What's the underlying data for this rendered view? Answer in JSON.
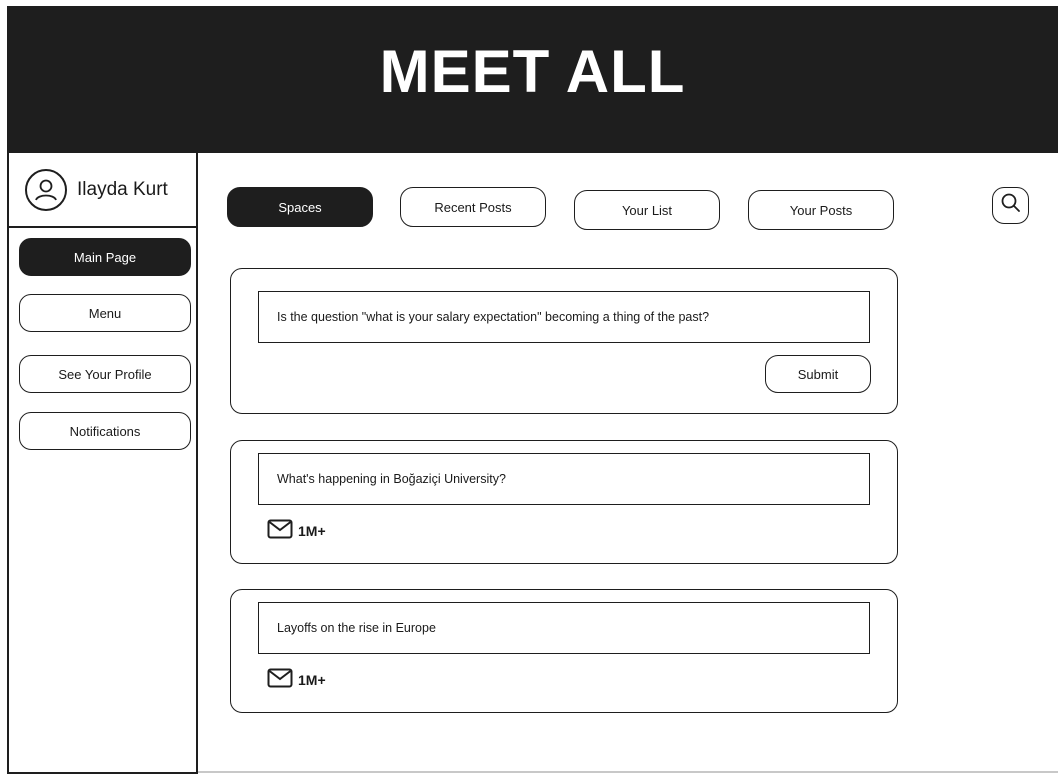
{
  "app": {
    "title": "MEET ALL"
  },
  "user": {
    "name": "Ilayda Kurt",
    "avatar_icon": "user-circle-icon"
  },
  "sidebar": {
    "items": [
      {
        "label": "Main Page",
        "active": true
      },
      {
        "label": "Menu",
        "active": false
      },
      {
        "label": "See Your Profile",
        "active": false
      },
      {
        "label": "Notifications",
        "active": false
      }
    ]
  },
  "tabs": [
    {
      "label": "Spaces",
      "active": true
    },
    {
      "label": "Recent Posts",
      "active": false
    },
    {
      "label": "Your List",
      "active": false
    },
    {
      "label": "Your Posts",
      "active": false
    }
  ],
  "search": {
    "icon": "search-icon"
  },
  "composer": {
    "question": "Is the question \"what is your salary expectation\" becoming a thing of the past?",
    "submit_label": "Submit"
  },
  "posts": [
    {
      "title": "What's happening in Boğaziçi University?",
      "icon": "mail-icon",
      "count": "1M+"
    },
    {
      "title": "Layoffs on the rise in Europe",
      "icon": "mail-icon",
      "count": "1M+"
    }
  ],
  "colors": {
    "dark": "#1e1e1e",
    "light": "#ffffff"
  }
}
